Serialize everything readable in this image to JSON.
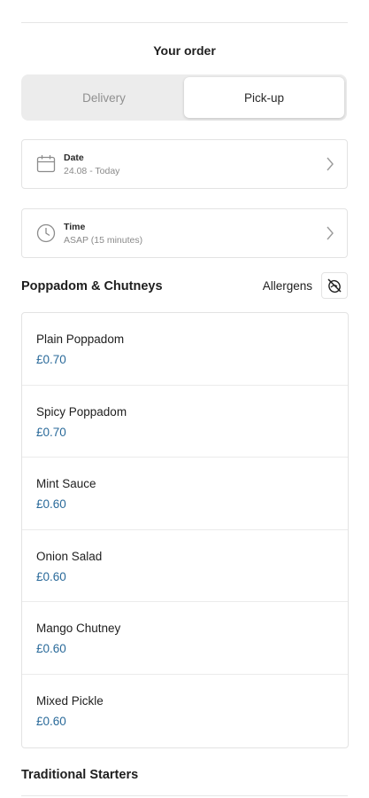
{
  "header": {
    "title": "Your order"
  },
  "order_type": {
    "options": [
      {
        "label": "Delivery",
        "selected": false
      },
      {
        "label": "Pick-up",
        "selected": true
      }
    ]
  },
  "date_picker": {
    "label": "Date",
    "value": "24.08 - Today",
    "icon": "calendar-icon"
  },
  "time_picker": {
    "label": "Time",
    "value": "ASAP (15 minutes)",
    "icon": "clock-icon"
  },
  "section": {
    "title": "Poppadom & Chutneys",
    "allergens_label": "Allergens",
    "allergens_icon": "allergen-filter-icon",
    "items": [
      {
        "name": "Plain Poppadom",
        "price": "£0.70"
      },
      {
        "name": "Spicy Poppadom",
        "price": "£0.70"
      },
      {
        "name": "Mint Sauce",
        "price": "£0.60"
      },
      {
        "name": "Onion Salad",
        "price": "£0.60"
      },
      {
        "name": "Mango Chutney",
        "price": "£0.60"
      },
      {
        "name": "Mixed Pickle",
        "price": "£0.60"
      }
    ]
  },
  "next_section": {
    "title": "Traditional Starters"
  },
  "colors": {
    "price": "#2a6a9a",
    "segment_bg": "#ececec",
    "border": "#e3e3e3"
  }
}
